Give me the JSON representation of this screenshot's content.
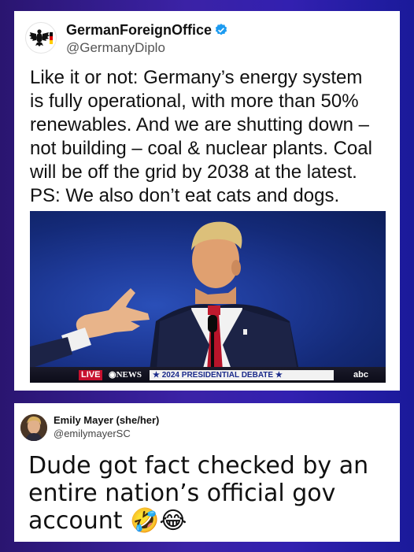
{
  "tweet1": {
    "author_name": "GermanForeignOffice",
    "handle": "@GermanyDiplo",
    "verified_icon": "verified-badge-icon",
    "text_lines": [
      "Like it or not: Germany’s energy system",
      "is fully operational, with more than 50%",
      "renewables. And we are shutting down –",
      "not building – coal & nuclear plants. Coal",
      "will be off the grid by 2038 at the latest.",
      "PS: We also don’t eat cats and dogs."
    ],
    "video": {
      "live_label": "LIVE",
      "news_label": "NEWS",
      "debate_label": "★ 2024 PRESIDENTIAL DEBATE ★",
      "network_label": "abc"
    }
  },
  "tweet2": {
    "author_name": "Emily Mayer (she/her)",
    "handle": "@emilymayerSC",
    "text_lines": [
      "Dude got fact checked by an",
      "entire nation’s official gov",
      "account 🤣😂"
    ]
  },
  "colors": {
    "background_left": "#2a1570",
    "background_right": "#1a1a9a",
    "verified_blue": "#1d9bf0",
    "live_red": "#c8102e"
  }
}
